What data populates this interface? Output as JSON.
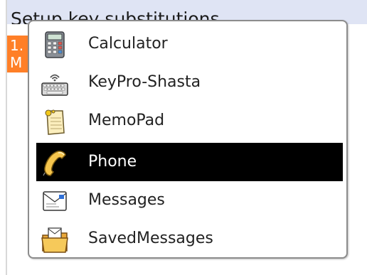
{
  "screen": {
    "title": "Setup key substitutions",
    "highlight_line1": "1.",
    "highlight_line2": "M"
  },
  "menu": {
    "selected_index": 3,
    "items": [
      {
        "label": "Calculator",
        "icon": "calculator-icon"
      },
      {
        "label": "KeyPro-Shasta",
        "icon": "keyboard-icon"
      },
      {
        "label": "MemoPad",
        "icon": "memopad-icon"
      },
      {
        "label": "Phone",
        "icon": "phone-icon"
      },
      {
        "label": "Messages",
        "icon": "messages-icon"
      },
      {
        "label": "SavedMessages",
        "icon": "saved-messages-icon"
      }
    ]
  },
  "colors": {
    "title_bar": "#dfe4f4",
    "highlight": "#ff7f27",
    "selected_row": "#000000",
    "popup_border": "#8c8c8c"
  }
}
